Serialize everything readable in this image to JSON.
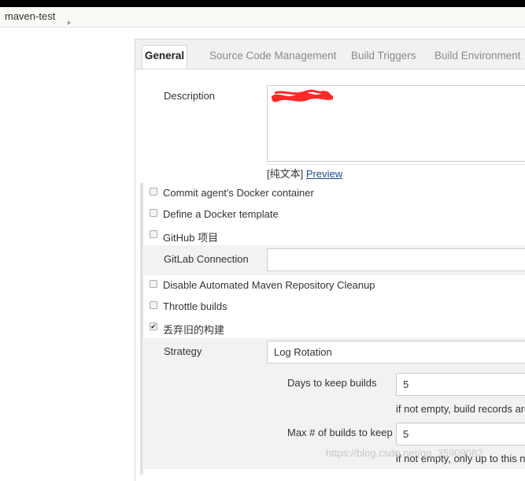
{
  "breadcrumb": {
    "job": "maven-test"
  },
  "tabs": [
    {
      "label": "General"
    },
    {
      "label": "Source Code Management"
    },
    {
      "label": "Build Triggers"
    },
    {
      "label": "Build Environment"
    }
  ],
  "description": {
    "label": "Description",
    "plain_text": "[纯文本]",
    "preview": "Preview"
  },
  "options": [
    {
      "label": "Commit agent's Docker container",
      "checked": false
    },
    {
      "label": "Define a Docker template",
      "checked": false
    },
    {
      "label": "GitHub 项目",
      "checked": false
    },
    {
      "label": "Disable Automated Maven Repository Cleanup",
      "checked": false
    },
    {
      "label": "Throttle builds",
      "checked": false
    },
    {
      "label": "丢弃旧的构建",
      "checked": true
    }
  ],
  "gitlab": {
    "label": "GitLab Connection",
    "value": ""
  },
  "strategy": {
    "label": "Strategy",
    "value": "Log Rotation"
  },
  "days_to_keep": {
    "label": "Days to keep builds",
    "value": "5",
    "help": "if not empty, build records are"
  },
  "max_builds": {
    "label": "Max # of builds to keep",
    "value": "5",
    "help": "if not empty, only up to this nu"
  },
  "watermark": "https://blog.csdn.net/qq_35909082",
  "colors": {
    "redaction": "#ff2a2a",
    "link": "#204a87",
    "tab_bar": "#f1f1f1"
  }
}
